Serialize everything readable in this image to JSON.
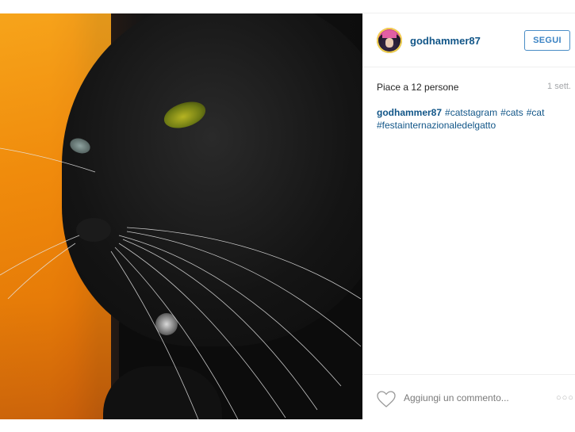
{
  "post": {
    "username": "godhammer87",
    "follow_label": "SEGUI",
    "likes_text": "Piace a 12 persone",
    "time_text": "1 sett.",
    "caption": {
      "user": "godhammer87",
      "hashtags": [
        "#catstagram",
        "#cats",
        "#cat",
        "#festainternazionaledelgatto"
      ]
    },
    "comment_placeholder": "Aggiungi un commento...",
    "more_label": "○○○"
  },
  "colors": {
    "link_blue": "#125688",
    "follow_border": "#4a8dc6",
    "photo_background": "#f08a0c"
  }
}
